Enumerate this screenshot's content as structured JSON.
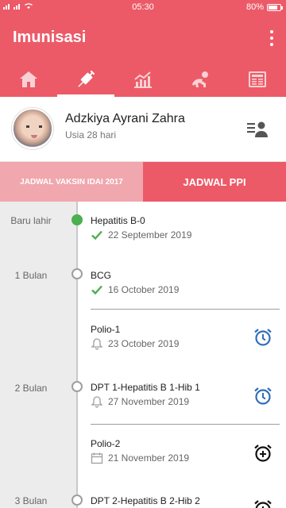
{
  "status_bar": {
    "time": "05:30",
    "battery": "80%",
    "battery_level": 0.8
  },
  "app_bar": {
    "title": "Imunisasi"
  },
  "tabs": [
    {
      "icon": "home-icon",
      "active": false
    },
    {
      "icon": "syringe-icon",
      "active": true
    },
    {
      "icon": "growth-chart-icon",
      "active": false
    },
    {
      "icon": "crawling-baby-icon",
      "active": false
    },
    {
      "icon": "newspaper-icon",
      "active": false
    }
  ],
  "profile": {
    "name": "Adzkiya Ayrani Zahra",
    "age": "Usia 28 hari"
  },
  "schedule_tabs": {
    "idai": "JADWAL VAKSIN IDAI 2017",
    "ppi": "JADWAL PPI"
  },
  "timeline": [
    {
      "age": "Baru lahir",
      "vaccine": "Hepatitis B-0",
      "date": "22 September 2019",
      "status": "done"
    },
    {
      "age": "1 Bulan",
      "vaccine": "BCG",
      "date": "16 October 2019",
      "status": "done"
    },
    {
      "age": "",
      "vaccine": "Polio-1",
      "date": "23 October 2019",
      "status": "reminder"
    },
    {
      "age": "2 Bulan",
      "vaccine": "DPT 1-Hepatitis B 1-Hib 1",
      "date": "27 November 2019",
      "status": "reminder"
    },
    {
      "age": "",
      "vaccine": "Polio-2",
      "date": "21 November 2019",
      "status": "scheduled"
    },
    {
      "age": "3 Bulan",
      "vaccine": "DPT 2-Hepatitis B 2-Hib 2",
      "date": "",
      "status": "scheduled"
    }
  ],
  "colors": {
    "primary": "#ec5a68",
    "tab_inactive": "#f0a7ad",
    "done": "#4caf50",
    "alarm": "#2f6fb8"
  }
}
